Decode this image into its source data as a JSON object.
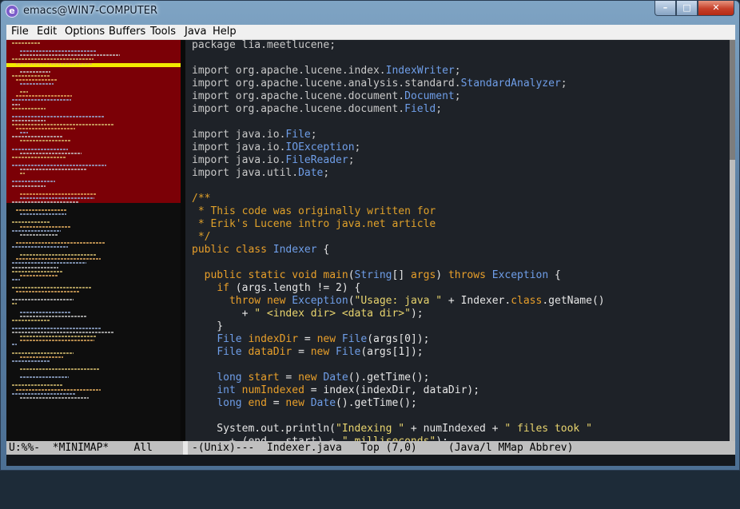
{
  "window": {
    "title": "emacs@WIN7-COMPUTER",
    "icon": "emacs-icon"
  },
  "window_buttons": {
    "minimize": "minimize-icon",
    "maximize": "maximize-icon",
    "close": "close-icon"
  },
  "menu": [
    "File",
    "Edit",
    "Options",
    "Buffers",
    "Tools",
    "Java",
    "Help"
  ],
  "code_lines": [
    [
      [
        "package ",
        "f"
      ],
      [
        "lia.meetlucene;",
        "f"
      ]
    ],
    [],
    [
      [
        "import ",
        "f"
      ],
      [
        "org.apache.lucene.index.",
        "f"
      ],
      [
        "IndexWriter",
        "t"
      ],
      [
        ";",
        "f"
      ]
    ],
    [
      [
        "import ",
        "f"
      ],
      [
        "org.apache.lucene.analysis.standard.",
        "f"
      ],
      [
        "StandardAnalyzer",
        "t"
      ],
      [
        ";",
        "f"
      ]
    ],
    [
      [
        "import ",
        "f"
      ],
      [
        "org.apache.lucene.document.",
        "f"
      ],
      [
        "Document",
        "t"
      ],
      [
        ";",
        "f"
      ]
    ],
    [
      [
        "import ",
        "f"
      ],
      [
        "org.apache.lucene.document.",
        "f"
      ],
      [
        "Field",
        "t"
      ],
      [
        ";",
        "f"
      ]
    ],
    [],
    [
      [
        "import ",
        "f"
      ],
      [
        "java.io.",
        "f"
      ],
      [
        "File",
        "t"
      ],
      [
        ";",
        "f"
      ]
    ],
    [
      [
        "import ",
        "f"
      ],
      [
        "java.io.",
        "f"
      ],
      [
        "IOException",
        "t"
      ],
      [
        ";",
        "f"
      ]
    ],
    [
      [
        "import ",
        "f"
      ],
      [
        "java.io.",
        "f"
      ],
      [
        "FileReader",
        "t"
      ],
      [
        ";",
        "f"
      ]
    ],
    [
      [
        "import ",
        "f"
      ],
      [
        "java.util.",
        "f"
      ],
      [
        "Date",
        "t"
      ],
      [
        ";",
        "f"
      ]
    ],
    [],
    [
      [
        "/**",
        "c"
      ]
    ],
    [
      [
        " * This code was originally written for",
        "c"
      ]
    ],
    [
      [
        " * Erik's Lucene intro java.net article",
        "c"
      ]
    ],
    [
      [
        " */",
        "c"
      ]
    ],
    [
      [
        "public ",
        "k"
      ],
      [
        "class ",
        "k"
      ],
      [
        "Indexer",
        "t"
      ],
      [
        " {",
        ""
      ]
    ],
    [],
    [
      [
        "  ",
        ""
      ],
      [
        "public ",
        "k"
      ],
      [
        "static ",
        "k"
      ],
      [
        "void ",
        "k"
      ],
      [
        "main",
        "k"
      ],
      [
        "(",
        ""
      ],
      [
        "String",
        "t"
      ],
      [
        "[] ",
        ""
      ],
      [
        "args",
        "k"
      ],
      [
        ") ",
        ""
      ],
      [
        "throws ",
        "k"
      ],
      [
        "Exception",
        "t"
      ],
      [
        " {",
        ""
      ]
    ],
    [
      [
        "    ",
        ""
      ],
      [
        "if ",
        "k"
      ],
      [
        "(args.length != 2) {",
        ""
      ]
    ],
    [
      [
        "      ",
        ""
      ],
      [
        "throw ",
        "k"
      ],
      [
        "new ",
        "k"
      ],
      [
        "Exception",
        "t"
      ],
      [
        "(",
        ""
      ],
      [
        "\"Usage: java \"",
        "s"
      ],
      [
        " + Indexer.",
        ""
      ],
      [
        "class",
        "k"
      ],
      [
        ".getName()",
        ""
      ]
    ],
    [
      [
        "        + ",
        ""
      ],
      [
        "\" <index dir> <data dir>\"",
        "s"
      ],
      [
        ");",
        ""
      ]
    ],
    [
      [
        "    }",
        ""
      ]
    ],
    [
      [
        "    ",
        ""
      ],
      [
        "File ",
        "t"
      ],
      [
        "indexDir",
        "k"
      ],
      [
        " = ",
        ""
      ],
      [
        "new ",
        "k"
      ],
      [
        "File",
        "t"
      ],
      [
        "(args[0]);",
        ""
      ]
    ],
    [
      [
        "    ",
        ""
      ],
      [
        "File ",
        "t"
      ],
      [
        "dataDir",
        "k"
      ],
      [
        " = ",
        ""
      ],
      [
        "new ",
        "k"
      ],
      [
        "File",
        "t"
      ],
      [
        "(args[1]);",
        ""
      ]
    ],
    [],
    [
      [
        "    ",
        ""
      ],
      [
        "long ",
        "t"
      ],
      [
        "start",
        "k"
      ],
      [
        " = ",
        ""
      ],
      [
        "new ",
        "k"
      ],
      [
        "Date",
        "t"
      ],
      [
        "().getTime();",
        ""
      ]
    ],
    [
      [
        "    ",
        ""
      ],
      [
        "int ",
        "t"
      ],
      [
        "numIndexed",
        "k"
      ],
      [
        " = index(indexDir, dataDir);",
        ""
      ]
    ],
    [
      [
        "    ",
        ""
      ],
      [
        "long ",
        "t"
      ],
      [
        "end",
        "k"
      ],
      [
        " = ",
        ""
      ],
      [
        "new ",
        "k"
      ],
      [
        "Date",
        "t"
      ],
      [
        "().getTime();",
        ""
      ]
    ],
    [],
    [
      [
        "    System.out.println(",
        ""
      ],
      [
        "\"Indexing \"",
        "s"
      ],
      [
        " + numIndexed + ",
        ""
      ],
      [
        "\" files took \"",
        "s"
      ]
    ],
    [
      [
        "      + (end - start) + ",
        ""
      ],
      [
        "\" milliseconds\"",
        "s"
      ],
      [
        ");",
        ""
      ]
    ]
  ],
  "modeline": {
    "left": "U:%%-  *MINIMAP*    All",
    "right": "-(Unix)---  Indexer.java   Top (7,0)     (Java/l MMap Abbrev)"
  }
}
